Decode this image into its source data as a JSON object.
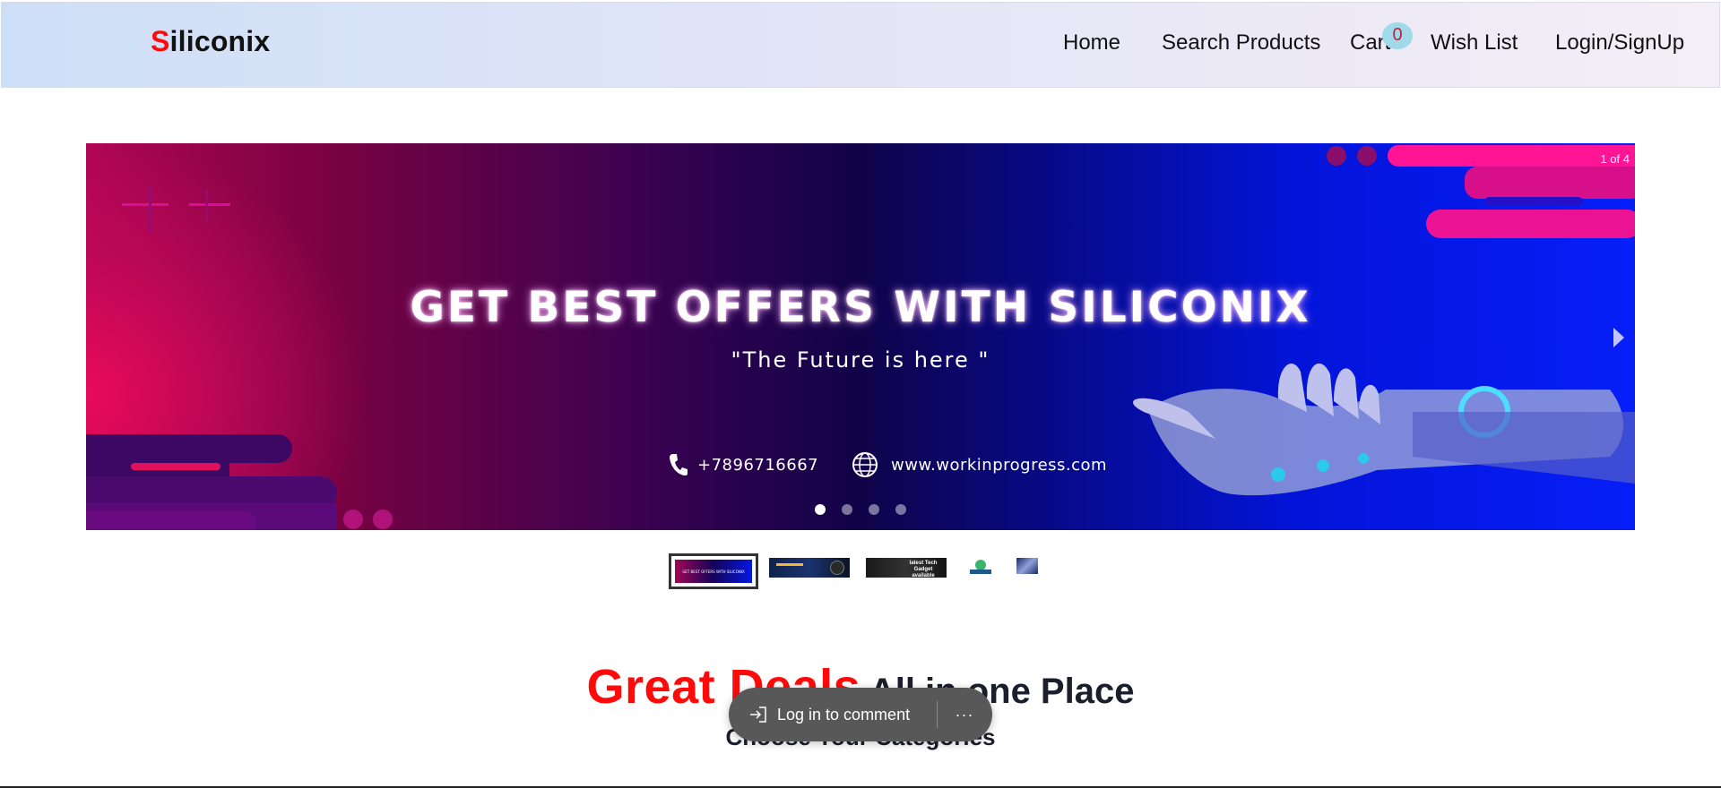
{
  "brand": {
    "first_letter": "S",
    "rest": "iliconix"
  },
  "nav": {
    "home": "Home",
    "search": "Search Products",
    "cart": "Cart",
    "cart_count": "0",
    "wishlist": "Wish List",
    "login": "Login/SignUp"
  },
  "carousel": {
    "counter": "1 of 4",
    "headline": "GET BEST OFFERS WITH SILICONIX",
    "tagline": "\"The Future is here \"",
    "phone": "+7896716667",
    "website": "www.workinprogress.com",
    "dot_count": 4,
    "active_dot": 1
  },
  "thumbnails": {
    "items": [
      "banner-1",
      "banner-2",
      "banner-3",
      "banner-4",
      "banner-5"
    ],
    "selected": 1,
    "texts": [
      "GET BEST OFFERS WITH SILICONIX",
      "latest Tech Gadget available"
    ]
  },
  "section": {
    "title_red": "Great Deals",
    "title_dark": " All in one Place",
    "subtitle": "Choose Your Categories"
  },
  "comment_bar": {
    "label": "Log in to comment",
    "more": "···"
  },
  "colors": {
    "accent_red": "#ff0a0a",
    "header_gradient_start": "#cddff7",
    "header_gradient_end": "#f4eef6",
    "banner_blue": "#061ef8",
    "banner_magenta": "#b00654",
    "badge_bg": "#9fd9ea"
  },
  "icons": [
    "phone-icon",
    "globe-icon",
    "chevron-right-icon",
    "sign-in-icon",
    "more-icon"
  ]
}
